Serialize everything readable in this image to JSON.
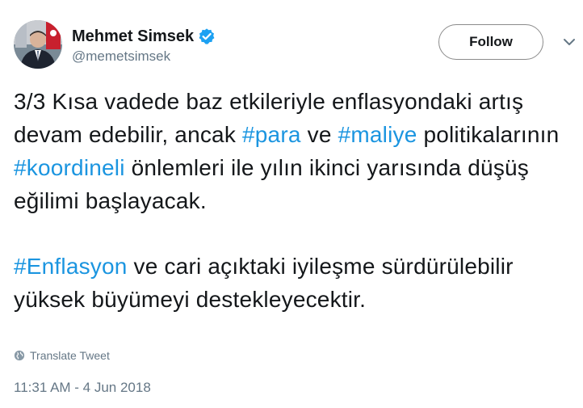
{
  "user": {
    "display_name": "Mehmet Simsek",
    "handle": "@memetsimsek",
    "verified": true
  },
  "follow_button": {
    "label": "Follow"
  },
  "tweet": {
    "para1": {
      "t1": "3/3 Kısa vadede baz etkileriyle enflasyondaki artış devam edebilir, ancak ",
      "h1": "#para",
      "t2": " ve ",
      "h2": "#maliye",
      "t3": " politikalarının ",
      "h3": "#koordineli",
      "t4": " önlemleri ile yılın ikinci yarısında düşüş eğilimi başlayacak."
    },
    "para2": {
      "h1": "#Enflasyon",
      "t1": " ve cari açıktaki iyileşme sürdürülebilir yüksek büyümeyi destekleyecektir."
    }
  },
  "translate_label": "Translate Tweet",
  "timestamp": "11:31 AM - 4 Jun 2018",
  "colors": {
    "hashtag": "#1b95e0",
    "verified": "#1da1f2",
    "text": "#14171a",
    "muted": "#657786"
  },
  "icons": [
    "verified-badge-icon",
    "chevron-down-icon",
    "globe-icon"
  ]
}
